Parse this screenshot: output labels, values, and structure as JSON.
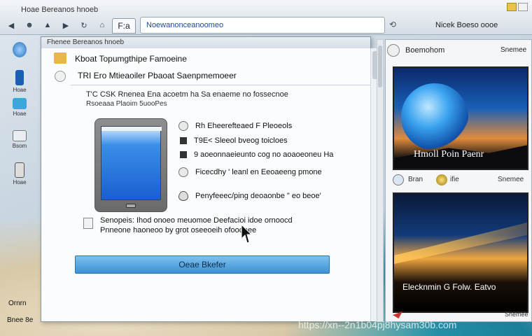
{
  "window": {
    "title": "Hoae Bereanos hnoeb"
  },
  "toolbar": {
    "tab_label": "F:a",
    "address": "Noewanonceanoomeo",
    "right_text": "Nicek Boeso oooe"
  },
  "desktop": {
    "icons": [
      {
        "name": "globe",
        "label": ""
      },
      {
        "name": "phone",
        "label": "Hoae"
      },
      {
        "name": "monitor",
        "label": "Hoae"
      },
      {
        "name": "file",
        "label": "Bsom"
      },
      {
        "name": "tablet",
        "label": "Hoae"
      }
    ],
    "bottom_left_1": "Ornrn",
    "bottom_left_2": "Bnee 8e"
  },
  "dialog": {
    "title": "Fhenee Bereanos hnoeb",
    "head1": "Kboat Topumgthipe Famoeine",
    "head2": "TRI Ero Mtieaoiler Pbaoat Saenpmemoeer",
    "line1": "T'C CSK Rnenea Ena acoetm ha Sa enaeme no fossecnoe",
    "line2": "Rsoeaaa Plaoim 5uooPes",
    "options": [
      {
        "icon": "radio-icon",
        "text": "Rh Eheerefteaed F Pleoeols"
      },
      {
        "icon": "square-icon",
        "text": "T9E<  Sleeol bveog toicloes"
      },
      {
        "icon": "square-icon",
        "text": "9 aoeonnaeieunto cog no aoaoeoneu Ha"
      },
      {
        "icon": "radio-icon",
        "text": "Ficecdhy ' leanl en Eeoaeeng pmone"
      },
      {
        "icon": "drop-icon",
        "text": "Penyfeeec/ping deoaonbe \" eo beoe'"
      }
    ],
    "note_line1": "Senopeis: Ihod  onoeo meuomoe Deefacioi idoe  ornoocd",
    "note_line2": "Pnneone haoneoo by grot oseeoeih ofooooee",
    "primary_button": "Oeae Bkefer"
  },
  "right_panel": {
    "header_title": "Boemohom",
    "header_side": "Snemee",
    "card1_caption": "Hmoll Poin Paenr",
    "mid_text1": "Bran",
    "mid_text2": "ifie",
    "mid_text3": "Snemee",
    "card2_caption": "Elecknmin G Folw. Eatvo",
    "footer_text": "Snemee"
  },
  "overlay": {
    "watermark": "https://xn--2n1b04pj8hysam30b.com"
  }
}
